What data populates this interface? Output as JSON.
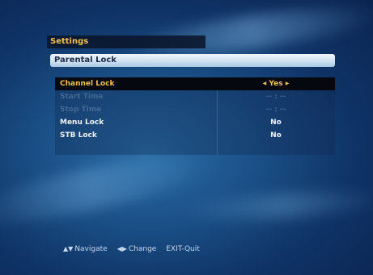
{
  "header": {
    "settings_label": "Settings"
  },
  "menu": {
    "title": "Parental Lock",
    "rows": [
      {
        "label": "Channel Lock",
        "value": "Yes",
        "selected": true,
        "enabled": true
      },
      {
        "label": "Start Time",
        "value": "-- : --",
        "selected": false,
        "enabled": false
      },
      {
        "label": "Stop Time",
        "value": "-- : --",
        "selected": false,
        "enabled": false
      },
      {
        "label": "Menu Lock",
        "value": "No",
        "selected": false,
        "enabled": true
      },
      {
        "label": "STB Lock",
        "value": "No",
        "selected": false,
        "enabled": true
      }
    ]
  },
  "help": {
    "navigate_icon": "up-down-arrows-icon",
    "navigate": "Navigate",
    "change_icon": "left-right-arrows-icon",
    "change": "Change",
    "exit": "EXIT-Quit"
  },
  "colors": {
    "accent": "#f0c050",
    "background": "#1a4f86",
    "selection": "#05080f"
  }
}
